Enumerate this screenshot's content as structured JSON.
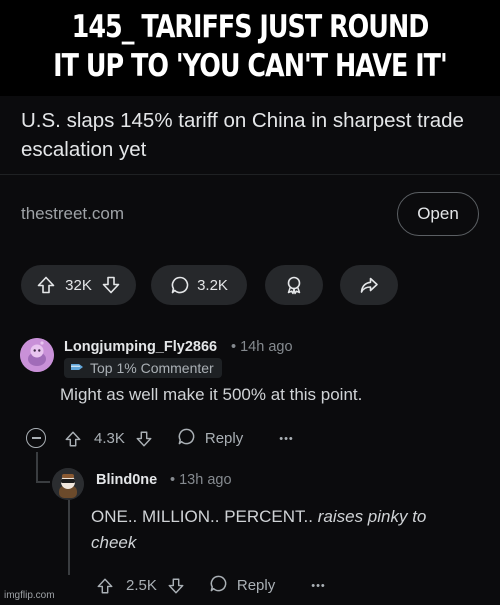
{
  "meme": {
    "caption_line1": "145_ TARIFFS JUST ROUND",
    "caption_line2": "IT UP TO 'YOU CAN'T HAVE IT'"
  },
  "post": {
    "headline": "U.S. slaps 145% tariff on China in sharpest trade escalation yet",
    "domain": "thestreet.com",
    "open_label": "Open",
    "upvotes": "32K",
    "comments": "3.2K"
  },
  "comments": [
    {
      "username": "Longjumping_Fly2866",
      "time": "14h ago",
      "flair": "Top 1% Commenter",
      "text": "Might as well make it 500% at this point.",
      "votes": "4.3K",
      "reply_label": "Reply",
      "more_label": "•••"
    },
    {
      "username": "Blind0ne",
      "time": "13h ago",
      "text_plain": "ONE.. MILLION.. PERCENT..",
      "text_italic": "raises pinky to cheek",
      "votes": "2.5K",
      "reply_label": "Reply",
      "more_label": "•••"
    }
  ],
  "watermark": "imgflip.com",
  "colors": {
    "background": "#0b0b0d",
    "pill": "#26282b",
    "text": "#e4e6e8",
    "muted": "#858a8f",
    "avatar": "#c991d8"
  },
  "icons": [
    "upvote-icon",
    "downvote-icon",
    "comment-bubble-icon",
    "award-icon",
    "share-icon",
    "collapse-icon",
    "more-icon"
  ]
}
